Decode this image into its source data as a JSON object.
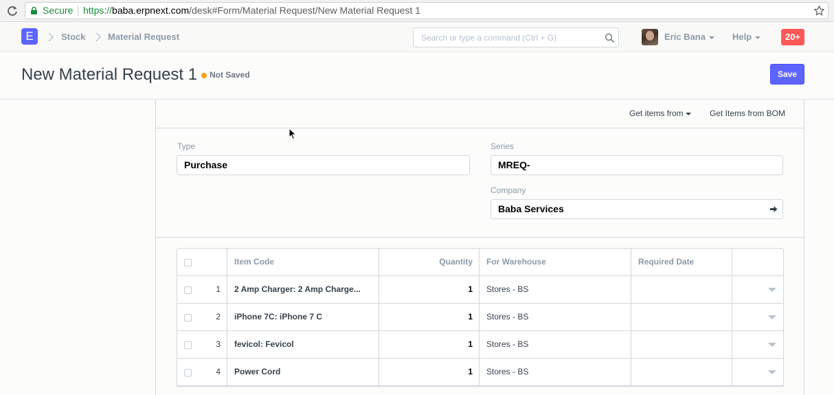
{
  "browser": {
    "secure_label": "Secure",
    "url_protocol": "https://",
    "url_host": "baba.erpnext.com",
    "url_path": "/desk#Form/Material Request/New Material Request 1"
  },
  "navbar": {
    "logo_letter": "E",
    "breadcrumbs": [
      "Stock",
      "Material Request"
    ],
    "search_placeholder": "Search or type a command (Ctrl + G)",
    "user_name": "Eric Bana",
    "help_label": "Help",
    "notification_count": "20+"
  },
  "page": {
    "title": "New Material Request 1",
    "status": "Not Saved",
    "save_label": "Save"
  },
  "toolbar": {
    "get_items_from": "Get items from",
    "get_items_bom": "Get Items from BOM"
  },
  "fields": {
    "type_label": "Type",
    "type_value": "Purchase",
    "series_label": "Series",
    "series_value": "MREQ-",
    "company_label": "Company",
    "company_value": "Baba Services"
  },
  "grid": {
    "columns": [
      "Item Code",
      "Quantity",
      "For Warehouse",
      "Required Date"
    ],
    "rows": [
      {
        "idx": "1",
        "item_code": "2 Amp Charger: 2 Amp Charge...",
        "qty": "1",
        "warehouse": "Stores - BS",
        "date": ""
      },
      {
        "idx": "2",
        "item_code": "iPhone 7C: iPhone 7 C",
        "qty": "1",
        "warehouse": "Stores - BS",
        "date": ""
      },
      {
        "idx": "3",
        "item_code": "fevicol: Fevicol",
        "qty": "1",
        "warehouse": "Stores - BS",
        "date": ""
      },
      {
        "idx": "4",
        "item_code": "Power Cord",
        "qty": "1",
        "warehouse": "Stores - BS",
        "date": ""
      }
    ]
  },
  "colors": {
    "primary": "#5e64ff",
    "status_dot": "#ffa00a",
    "notification": "#ff5858",
    "secure_green": "#1e8a3c"
  }
}
